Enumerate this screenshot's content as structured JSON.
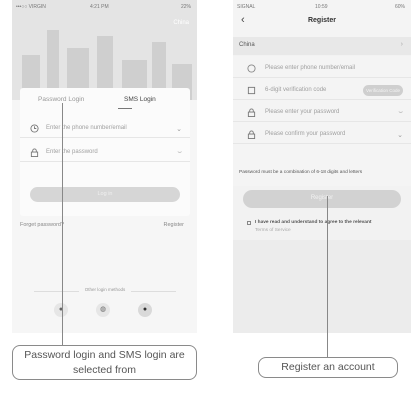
{
  "left": {
    "status": {
      "carrier": "•••○○ VIRGIN",
      "time": "4:21 PM",
      "battery": "22%"
    },
    "country": "China",
    "tabs": {
      "password": "Password Login",
      "sms": "SMS Login"
    },
    "phone_placeholder": "Enter the phone number/email",
    "password_placeholder": "Enter the password",
    "login_button": "Log in",
    "forgot": "Forget password?",
    "register": "Register",
    "other_methods": "Other login methods"
  },
  "right": {
    "status": {
      "signal": "SIGNAL",
      "time": "10:59",
      "battery": "60%"
    },
    "back_icon": "‹",
    "title": "Register",
    "country": "China",
    "fields": {
      "phone": "Please enter phone number/email",
      "code": "6-digit verification code",
      "code_button": "Verification Code",
      "password": "Please enter your password",
      "confirm": "Please confirm your password"
    },
    "hint": "Password must be a combination of 6-18 digits and letters",
    "register_button": "Register",
    "agree_text": "I have read and understand to agree to the relevant",
    "terms": "Terms of Service"
  },
  "callouts": {
    "left": "Password login and SMS login are selected from",
    "right": "Register an account"
  },
  "colors": {
    "line": "#888888",
    "button_gray": "#d4d4d4"
  },
  "icons": [
    "clock-icon",
    "lock-icon",
    "chevron-down-icon",
    "arrow-right-icon",
    "message-icon",
    "apple-icon",
    "back-icon",
    "user-icon"
  ]
}
